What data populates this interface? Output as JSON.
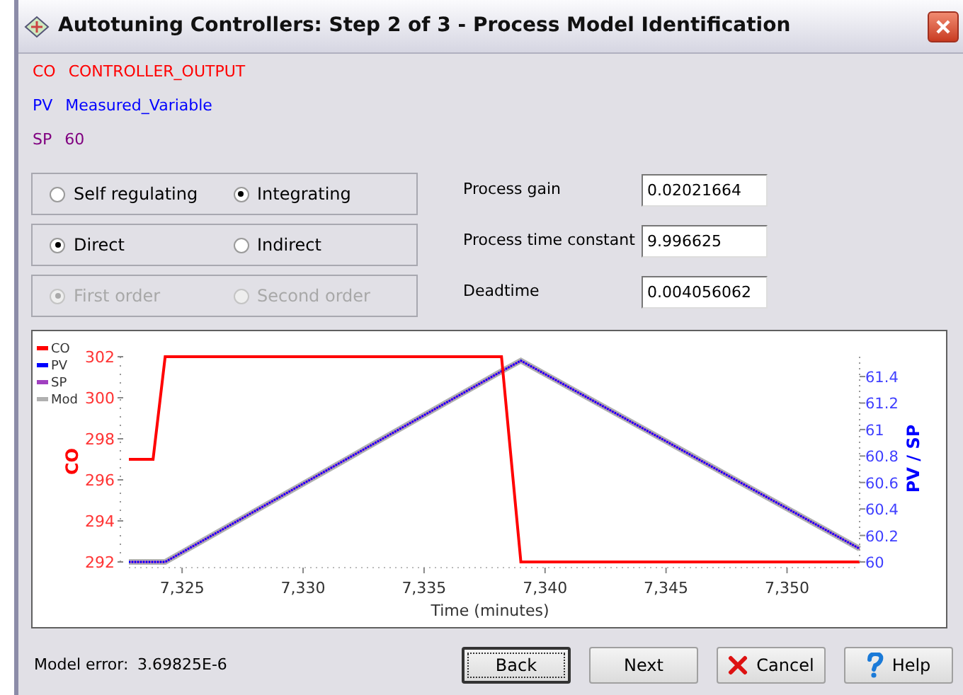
{
  "window": {
    "title": "Autotuning Controllers: Step 2 of 3 - Process Model Identification"
  },
  "variables": [
    {
      "tag": "CO",
      "name": "CONTROLLER_OUTPUT",
      "color": "#ff0000"
    },
    {
      "tag": "PV",
      "name": "Measured_Variable",
      "color": "#0000ff"
    },
    {
      "tag": "SP",
      "name": "60",
      "color": "#800080"
    }
  ],
  "option_groups": [
    {
      "disabled": false,
      "options": [
        {
          "label": "Self regulating",
          "selected": false
        },
        {
          "label": "Integrating",
          "selected": true
        }
      ]
    },
    {
      "disabled": false,
      "options": [
        {
          "label": "Direct",
          "selected": true
        },
        {
          "label": "Indirect",
          "selected": false
        }
      ]
    },
    {
      "disabled": true,
      "options": [
        {
          "label": "First order",
          "selected": true
        },
        {
          "label": "Second order",
          "selected": false
        }
      ]
    }
  ],
  "parameters": [
    {
      "label": "Process gain",
      "value": "0.02021664"
    },
    {
      "label": "Process time constant",
      "value": "9.996625"
    },
    {
      "label": "Deadtime",
      "value": "0.004056062"
    }
  ],
  "chart": {
    "chart_data": {
      "type": "line",
      "xlabel": "Time (minutes)",
      "ylabel": "CO",
      "y2label": "PV / SP",
      "x": [
        7322.8,
        7323.8,
        7324.3,
        7338.2,
        7339,
        7353
      ],
      "series": [
        {
          "name": "CO",
          "color": "#ff0000",
          "values": [
            297,
            297,
            302,
            302,
            292,
            292
          ]
        },
        {
          "name": "PV",
          "color": "#0000ff",
          "axis": "y2",
          "line_style": "dotted",
          "values": [
            60,
            60,
            60,
            61.44,
            61.52,
            60.1
          ]
        },
        {
          "name": "SP",
          "color": "#a040c0",
          "axis": "y2",
          "values": [
            60,
            60,
            60,
            61.44,
            61.52,
            60.1
          ]
        },
        {
          "name": "Mod",
          "color": "#b0b0b0",
          "axis": "y2",
          "values": [
            60,
            60,
            60,
            61.44,
            61.52,
            60.1
          ]
        }
      ],
      "legend": "top-left",
      "xlim": [
        7322.8,
        7353
      ],
      "ylim": [
        292,
        302
      ],
      "y2lim": [
        60,
        61.55
      ],
      "xticks": [
        {
          "value": 7325,
          "label": "7,325"
        },
        {
          "value": 7330,
          "label": "7,330"
        },
        {
          "value": 7335,
          "label": "7,335"
        },
        {
          "value": 7340,
          "label": "7,340"
        },
        {
          "value": 7345,
          "label": "7,345"
        },
        {
          "value": 7350,
          "label": "7,350"
        }
      ],
      "yticks": [
        292,
        294,
        296,
        298,
        300,
        302
      ],
      "y2ticks": [
        60,
        60.2,
        60.4,
        60.6,
        60.8,
        61,
        61.2,
        61.4
      ]
    }
  },
  "status": {
    "label": "Model error:",
    "value": "3.69825E-6"
  },
  "buttons": [
    {
      "label": "Back",
      "kind": "focused"
    },
    {
      "label": "Next",
      "kind": "plain"
    },
    {
      "label": "Cancel",
      "kind": "cancel"
    },
    {
      "label": "Help",
      "kind": "help"
    }
  ]
}
